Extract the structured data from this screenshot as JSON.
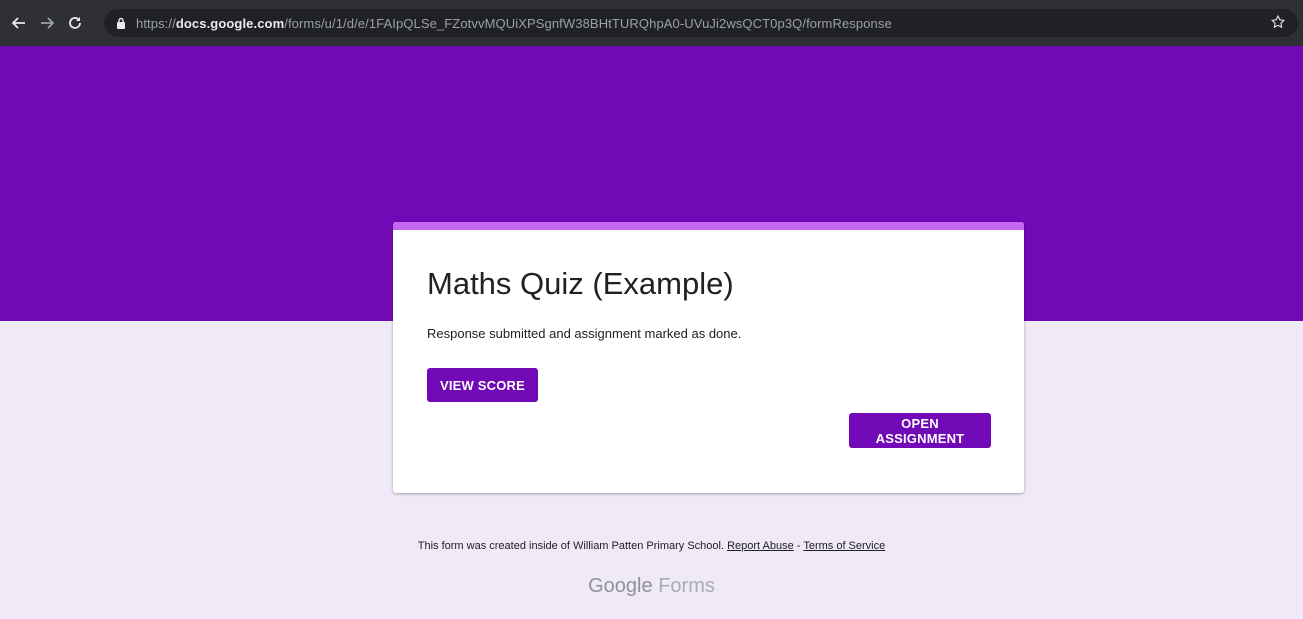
{
  "browser": {
    "url_protocol": "https://",
    "url_host": "docs.google.com",
    "url_path": "/forms/u/1/d/e/1FAIpQLSe_FZotvvMQUiXPSgnfW38BHtTURQhpA0-UVuJi2wsQCT0p3Q/formResponse",
    "icons": [
      "back-arrow-icon",
      "forward-arrow-icon",
      "reload-icon",
      "lock-icon",
      "star-icon"
    ]
  },
  "theme": {
    "header_color": "#7209b7",
    "accent_color": "#c468f3",
    "page_bg": "#f0e9f7",
    "button_color": "#7209b7"
  },
  "form": {
    "title": "Maths Quiz (Example)",
    "message": "Response submitted and assignment marked as done.",
    "view_score_label": "VIEW SCORE",
    "open_assignment_label": "OPEN ASSIGNMENT"
  },
  "footer": {
    "text": "This form was created inside of William Patten Primary School.",
    "report_abuse": "Report Abuse",
    "separator": " - ",
    "terms": "Terms of Service",
    "brand_google": "Google",
    "brand_forms": "Forms"
  }
}
